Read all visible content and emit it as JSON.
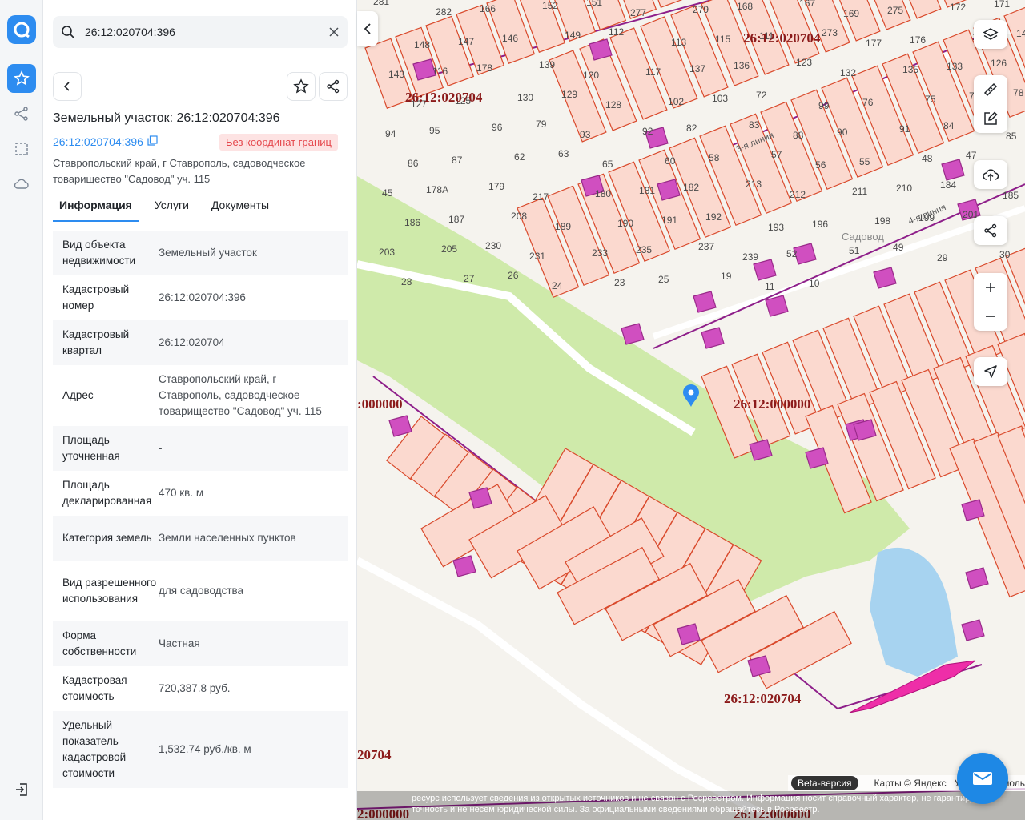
{
  "search": {
    "value": "26:12:020704:396"
  },
  "panel": {
    "title": "Земельный участок: 26:12:020704:396",
    "cad_number_link": "26:12:020704:396",
    "badge": "Без координат границ",
    "address": "Ставропольский край, г Ставрополь, садоводческое товарищество \"Садовод\" уч. 115",
    "tabs": [
      "Информация",
      "Услуги",
      "Документы"
    ],
    "rows": [
      {
        "k": "Вид объекта недвижимости",
        "v": "Земельный участок"
      },
      {
        "k": "Кадастровый номер",
        "v": "26:12:020704:396"
      },
      {
        "k": "Кадастровый квартал",
        "v": "26:12:020704"
      },
      {
        "k": "Адрес",
        "v": "Ставропольский край, г Ставрополь, садоводческое товарищество \"Садовод\" уч. 115"
      },
      {
        "k": "Площадь уточненная",
        "v": "-"
      },
      {
        "k": "Площадь декларированная",
        "v": "470 кв. м"
      },
      {
        "k": "Категория земель",
        "v": "Земли населенных пунктов"
      },
      {
        "k": "Вид разрешенного использования",
        "v": "для садоводства"
      },
      {
        "k": "Форма собственности",
        "v": "Частная"
      },
      {
        "k": "Кадастровая стоимость",
        "v": "720,387.8 руб."
      },
      {
        "k": "Удельный показатель кадастровой стоимости",
        "v": "1,532.74 руб./кв. м"
      }
    ]
  },
  "map": {
    "quarter_labels": [
      "26:12:020704",
      "26:12:020704",
      "26:12:000000",
      ":000000",
      "26:12:020704",
      "20704",
      "2:000000",
      "26:12:000000"
    ],
    "street_labels": [
      "3-я линия",
      "4-я линия",
      "Садовод"
    ],
    "parcel_numbers": [
      "281",
      "282",
      "166",
      "152",
      "151",
      "277",
      "279",
      "168",
      "167",
      "169",
      "275",
      "172",
      "171",
      "148",
      "147",
      "146",
      "149",
      "112",
      "113",
      "115",
      "111",
      "273",
      "177",
      "176",
      "140",
      "141",
      "143",
      "116",
      "178",
      "139",
      "120",
      "117",
      "137",
      "136",
      "123",
      "132",
      "135",
      "133",
      "126",
      "127",
      "125",
      "130",
      "129",
      "128",
      "102",
      "103",
      "72",
      "99",
      "76",
      "75",
      "77",
      "78",
      "94",
      "95",
      "96",
      "79",
      "93",
      "92",
      "82",
      "83",
      "88",
      "90",
      "91",
      "84",
      "85",
      "86",
      "87",
      "62",
      "63",
      "65",
      "60",
      "58",
      "57",
      "56",
      "55",
      "48",
      "47",
      "46",
      "45",
      "178А",
      "179",
      "217",
      "180",
      "181",
      "182",
      "213",
      "212",
      "211",
      "210",
      "184",
      "185",
      "186",
      "187",
      "208",
      "189",
      "190",
      "191",
      "192",
      "193",
      "196",
      "198",
      "199",
      "201",
      "202",
      "203",
      "205",
      "230",
      "231",
      "233",
      "235",
      "237",
      "239",
      "52",
      "51",
      "49",
      "29",
      "30",
      "28",
      "27",
      "26",
      "24",
      "23",
      "25",
      "19",
      "11",
      "10"
    ],
    "attribution": {
      "beta": "Beta-версия",
      "maps": "Карты © Яндекс",
      "terms": "Условия исполь"
    },
    "disclaimer": "ресурс использует сведения из открытых источников и не связан с Росреестром. Информация носит справочный характер, не гарантируем точность и не несем юридической силы. За официальными сведениями обращайтесь в Росреестр."
  },
  "colors": {
    "accent": "#2d8cf0",
    "parcel_fill": "#fbd9cf",
    "parcel_stroke": "#d9492b",
    "quarter_text": "#8b1a1a",
    "green": "#cfeaaa",
    "water": "#a7d3f0",
    "building": "#d04fc0"
  },
  "icons": [
    "logo-icon",
    "star-icon",
    "route-icon",
    "select-area-icon",
    "cloud-icon",
    "logout-icon",
    "search-icon",
    "close-icon",
    "back-icon",
    "favorite-icon",
    "share-icon",
    "copy-icon",
    "chevron-left-icon",
    "layers-icon",
    "ruler-icon",
    "edit-icon",
    "upload-icon",
    "share-map-icon",
    "zoom-in-icon",
    "zoom-out-icon",
    "locate-icon",
    "pin-icon",
    "mail-icon"
  ]
}
